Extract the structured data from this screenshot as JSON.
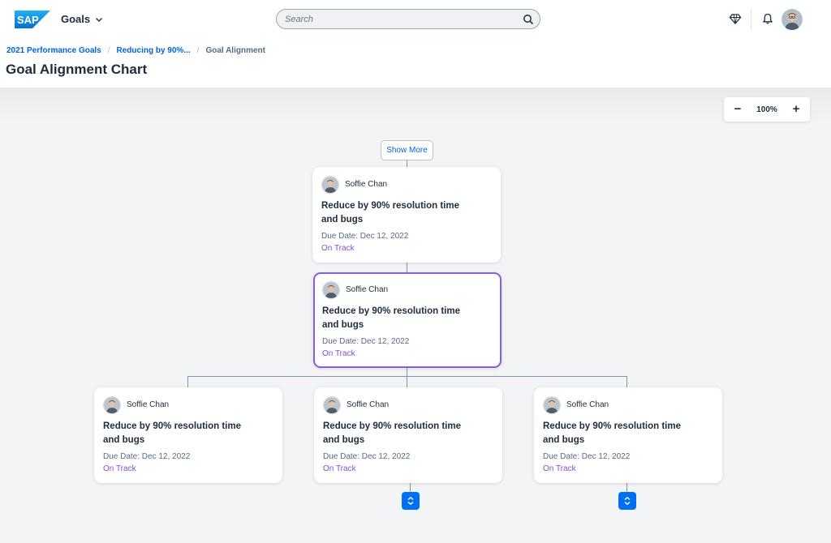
{
  "shell": {
    "logo_text": "SAP",
    "app_title": "Goals",
    "search_placeholder": "Search",
    "icons": [
      "sap-logo-icon",
      "chevron-down-icon",
      "search-icon",
      "diamond-icon",
      "bell-icon",
      "user-avatar-icon"
    ]
  },
  "breadcrumb": {
    "items": [
      "2021 Performance Goals",
      "Reducing by 90%...",
      "Goal Alignment"
    ],
    "separator": "/"
  },
  "page_title": "Goal Alignment Chart",
  "zoom": {
    "minus": "−",
    "value": "100%",
    "plus": "+"
  },
  "show_more": "Show More",
  "cards": [
    {
      "name": "Soffie Chan",
      "title": "Reduce by 90% resolution time and bugs",
      "due": "Due Date: Dec 12, 2022",
      "status": "On Track"
    },
    {
      "name": "Soffie Chan",
      "title": "Reduce by 90% resolution time and bugs",
      "due": "Due Date: Dec 12, 2022",
      "status": "On Track",
      "selected": true
    },
    {
      "name": "Soffie Chan",
      "title": "Reduce by 90% resolution time and bugs",
      "due": "Due Date: Dec 12, 2022",
      "status": "On Track"
    },
    {
      "name": "Soffie Chan",
      "title": "Reduce by 90% resolution time and bugs",
      "due": "Due Date: Dec 12, 2022",
      "status": "On Track"
    },
    {
      "name": "Soffie Chan",
      "title": "Reduce by 90% resolution time and bugs",
      "due": "Due Date: Dec 12, 2022",
      "status": "On Track"
    }
  ],
  "colors": {
    "brand": "#0070f2",
    "link": "#0064d9",
    "status_on_track": "#7a52d1",
    "selected_border": "#8a5fd0",
    "canvas": "#f3f4f5"
  }
}
